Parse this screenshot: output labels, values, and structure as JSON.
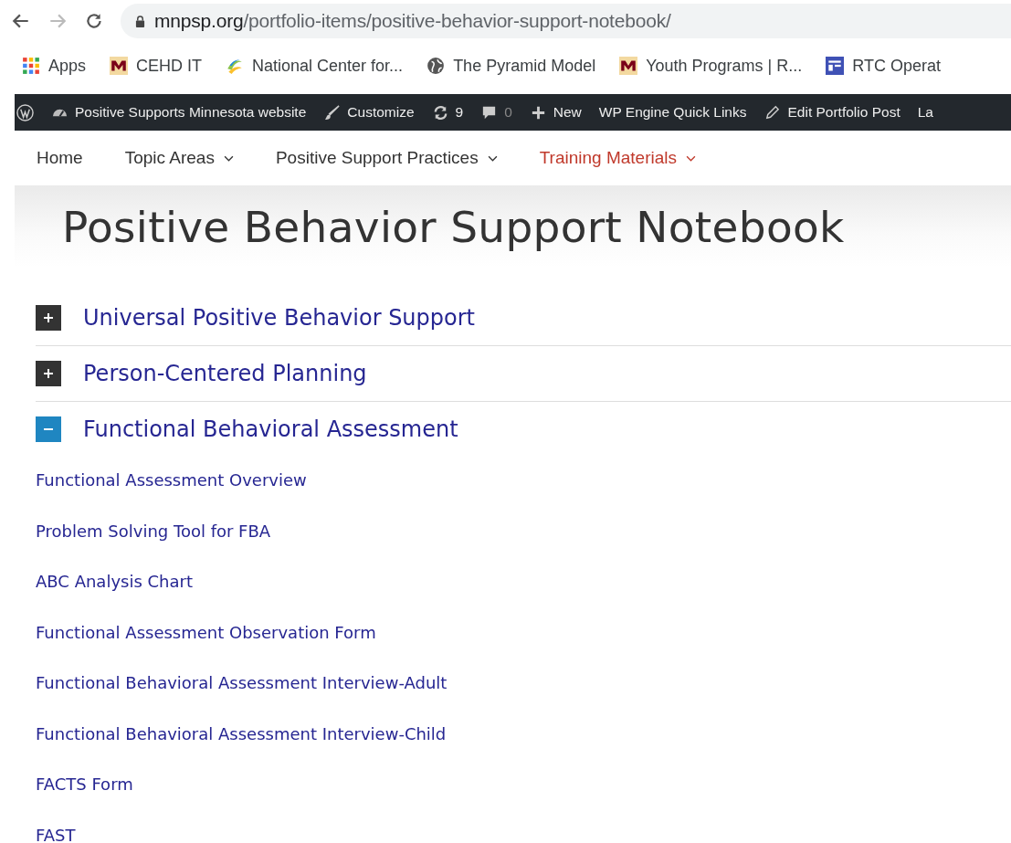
{
  "browser": {
    "url_host": "mnpsp.org",
    "url_path": "/portfolio-items/positive-behavior-support-notebook/"
  },
  "bookmarks": [
    {
      "label": "Apps",
      "kind": "apps"
    },
    {
      "label": "CEHD IT",
      "kind": "umn"
    },
    {
      "label": "National Center for...",
      "kind": "swirl"
    },
    {
      "label": "The Pyramid Model",
      "kind": "globe"
    },
    {
      "label": "Youth Programs | R...",
      "kind": "umn"
    },
    {
      "label": "RTC Operat",
      "kind": "tile"
    }
  ],
  "admin_bar": [
    {
      "kind": "wp"
    },
    {
      "label": "Positive Supports Minnesota website",
      "kind": "dashboard"
    },
    {
      "label": "Customize",
      "kind": "brush"
    },
    {
      "label": "9",
      "kind": "updates"
    },
    {
      "label": "0",
      "kind": "comments"
    },
    {
      "label": "New",
      "kind": "plus"
    },
    {
      "label": "WP Engine Quick Links",
      "kind": "text"
    },
    {
      "label": "Edit Portfolio Post",
      "kind": "pencil"
    },
    {
      "label": "La",
      "kind": "text"
    }
  ],
  "nav": [
    {
      "label": "Home",
      "has_menu": false,
      "selected": false
    },
    {
      "label": "Topic Areas",
      "has_menu": true,
      "selected": false
    },
    {
      "label": "Positive Support Practices",
      "has_menu": true,
      "selected": false
    },
    {
      "label": "Training Materials",
      "has_menu": true,
      "selected": true
    }
  ],
  "page_title": "Positive Behavior Support Notebook",
  "accordion": [
    {
      "title": "Universal Positive Behavior Support",
      "expanded": false
    },
    {
      "title": "Person-Centered Planning",
      "expanded": false
    },
    {
      "title": "Functional Behavioral Assessment",
      "expanded": true,
      "links": [
        "Functional Assessment Overview",
        "Problem Solving Tool for FBA",
        "ABC Analysis Chart",
        "Functional Assessment Observation Form",
        "Functional Behavioral Assessment Interview-Adult",
        "Functional Behavioral Assessment Interview-Child",
        "FACTS Form",
        "FAST"
      ]
    }
  ]
}
